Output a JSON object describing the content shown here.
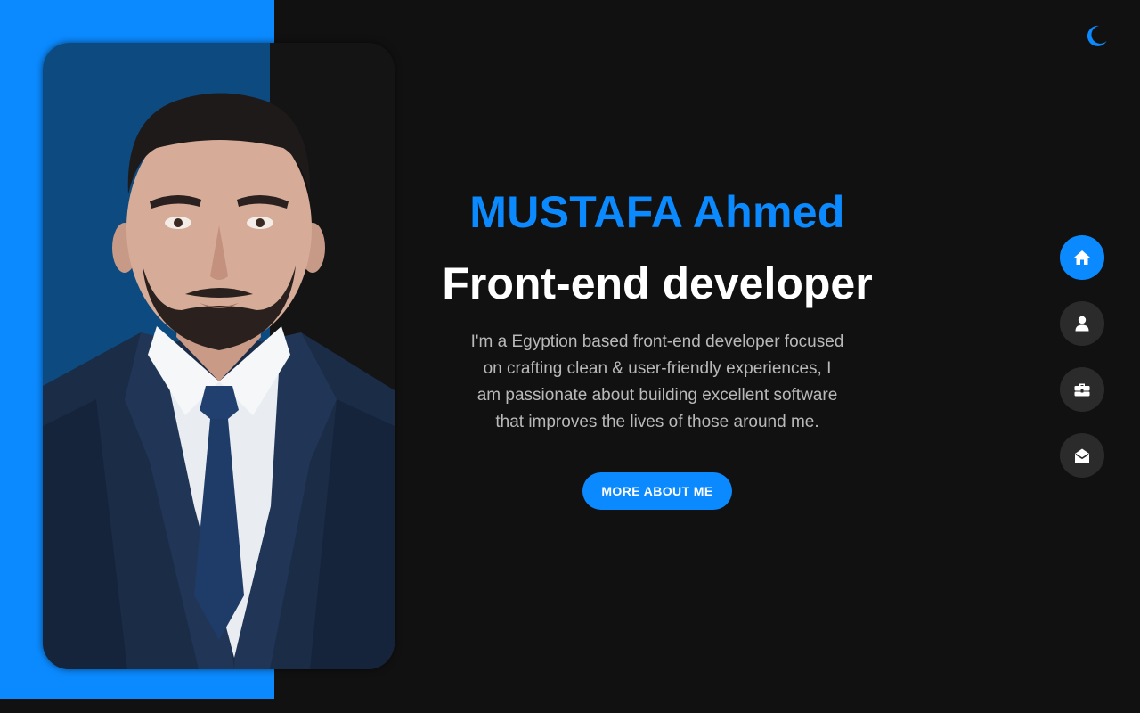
{
  "colors": {
    "accent": "#0b8aff",
    "background": "#111111",
    "nav_inactive": "#2b2b2b",
    "text_primary": "#ffffff",
    "text_muted": "#b9b9b9"
  },
  "hero": {
    "name": "MUSTAFA Ahmed",
    "role": "Front-end developer",
    "bio": "I'm a Egyption based front-end developer focused on crafting clean & user-friendly experiences, I am passionate about building excellent software that improves the lives of those around me.",
    "cta_label": "MORE ABOUT ME"
  },
  "theme_toggle": {
    "icon": "moon-icon"
  },
  "nav": {
    "items": [
      {
        "icon": "home-icon",
        "active": true
      },
      {
        "icon": "user-icon",
        "active": false
      },
      {
        "icon": "briefcase-icon",
        "active": false
      },
      {
        "icon": "envelope-open-icon",
        "active": false
      }
    ]
  },
  "profile_photo": {
    "subject": "portrait-photo"
  }
}
